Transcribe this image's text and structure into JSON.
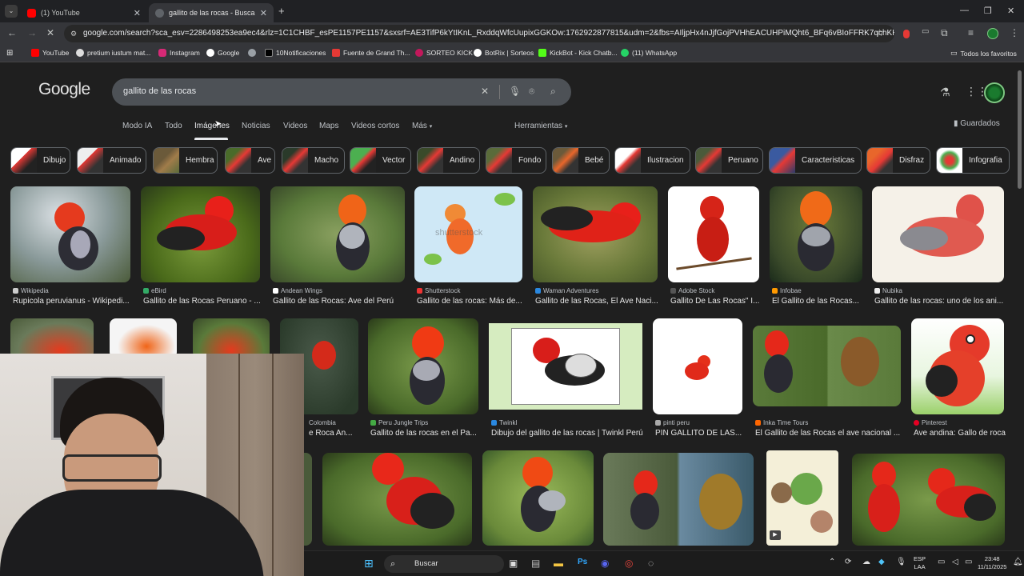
{
  "tabs": [
    {
      "title": "(1) YouTube",
      "active": false
    },
    {
      "title": "gallito de las rocas - Buscar con Google",
      "active": true
    }
  ],
  "new_tab_glyph": "+",
  "omnibox": {
    "url": "google.com/search?sca_esv=2286498253ea9ec4&rlz=1C1CHBF_esPE1157PE1157&sxsrf=AE3TifP6kYtIKnL_RxddqWfcUupixGGKOw:1762922877815&udm=2&fbs=AIljpHx4nJjfGojPVHhEACUHPiMQht6_BFq6vBIoFFRK7qchKHDX9TtpZ992ky..."
  },
  "bookmarks": [
    {
      "label": "YouTube",
      "color": "#ff0000"
    },
    {
      "label": "pretium iustum mat...",
      "color": "#ffffff"
    },
    {
      "label": "Instagram",
      "color": "#d62976"
    },
    {
      "label": "Google",
      "color": "#ffffff"
    },
    {
      "label": "",
      "color": "#9aa0a6"
    },
    {
      "label": "10Notificaciones",
      "color": "#ffffff"
    },
    {
      "label": "Fuente de Grand Th...",
      "color": "#e53935"
    },
    {
      "label": "SORTEO KICK",
      "color": "#c2185b"
    },
    {
      "label": "BotRix | Sorteos",
      "color": "#ffffff"
    },
    {
      "label": "KickBot - Kick Chatb...",
      "color": "#53fc18"
    },
    {
      "label": "(11) WhatsApp",
      "color": "#25d366"
    }
  ],
  "bookmarks_all": "Todos los favoritos",
  "google": {
    "logo": "Google",
    "query": "gallito de las rocas",
    "saved": "Guardados"
  },
  "nav_tabs": [
    "Modo IA",
    "Todo",
    "Imágenes",
    "Noticias",
    "Videos",
    "Maps",
    "Videos cortos",
    "Más"
  ],
  "tools": "Herramientas",
  "chips": [
    "Dibujo",
    "Animado",
    "Hembra",
    "Ave",
    "Macho",
    "Vector",
    "Andino",
    "Fondo",
    "Bebé",
    "Ilustracion",
    "Peruano",
    "Caracteristicas",
    "Disfraz",
    "Infografia"
  ],
  "results_row1": [
    {
      "source": "Wikipedia",
      "title": "Rupicola peruvianus - Wikipedi..."
    },
    {
      "source": "eBird",
      "title": "Gallito de las Rocas Peruano - ..."
    },
    {
      "source": "Andean Wings",
      "title": "Gallito de las Rocas: Ave del Perú"
    },
    {
      "source": "Shutterstock",
      "title": "Gallito de las rocas: Más de..."
    },
    {
      "source": "Waman Adventures",
      "title": "Gallito de las Rocas, El Ave Naci..."
    },
    {
      "source": "Adobe Stock",
      "title": "Gallito De Las Rocas\" I..."
    },
    {
      "source": "Infobae",
      "title": "El Gallito de las Rocas..."
    },
    {
      "source": "Nubika",
      "title": "Gallito de las rocas: uno de los ani..."
    }
  ],
  "results_row2": [
    {
      "source": "Colombia",
      "title": "e Roca An..."
    },
    {
      "source": "Peru Jungle Trips",
      "title": "Gallito de las rocas en el Pa..."
    },
    {
      "source": "Twinkl",
      "title": "Dibujo del gallito de las rocas | Twinkl Perú"
    },
    {
      "source": "pinti peru",
      "title": "PIN GALLITO DE LAS..."
    },
    {
      "source": "Inka Time Tours",
      "title": "El Gallito de las Rocas el ave nacional ..."
    },
    {
      "source": "Pinterest",
      "title": "Ave andina: Gallo de roca"
    }
  ],
  "image_overlay": "shutterstock",
  "taskbar": {
    "search": "Buscar",
    "lang_top": "ESP",
    "lang_bottom": "LAA",
    "time": "23:48",
    "date": "11/11/2025"
  }
}
